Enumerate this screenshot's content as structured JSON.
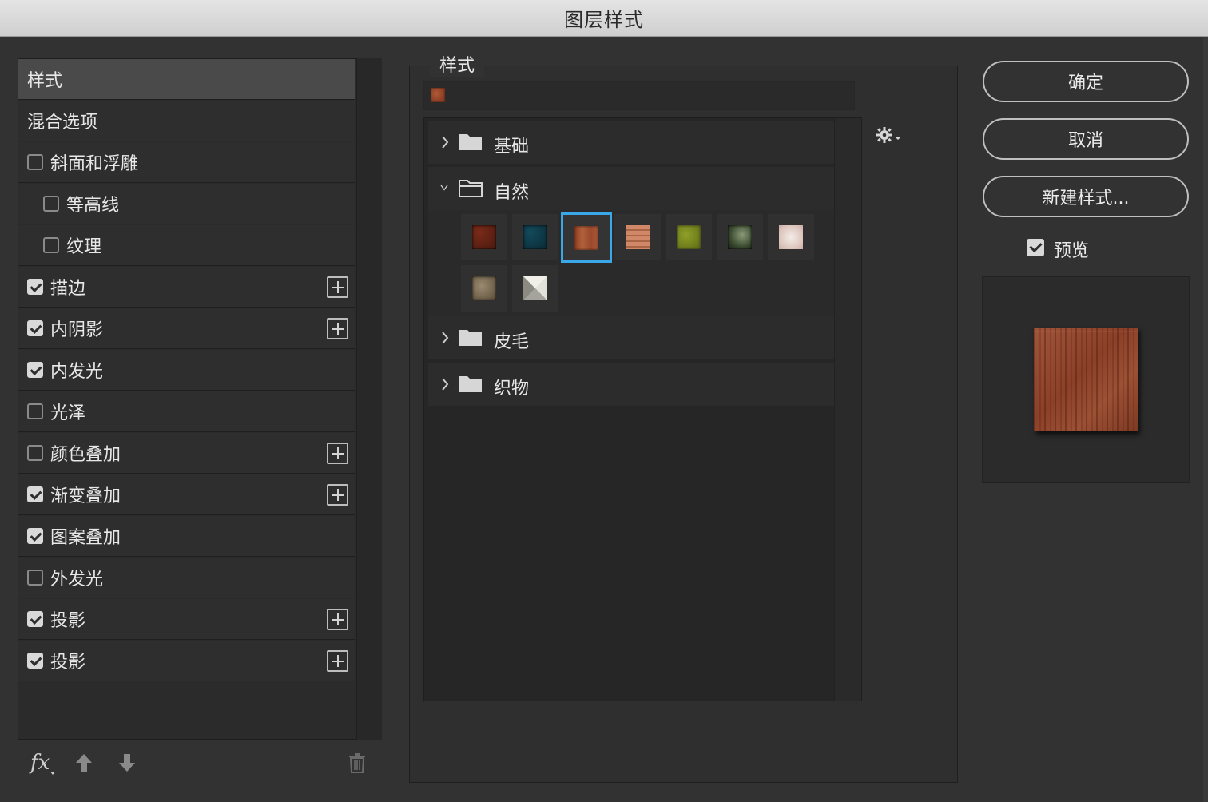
{
  "window": {
    "title": "图层样式"
  },
  "left_panel": {
    "items": [
      {
        "label": "样式",
        "type": "header",
        "checkbox": null,
        "plus": false,
        "indent": false
      },
      {
        "label": "混合选项",
        "type": "plain",
        "checkbox": null,
        "plus": false,
        "indent": false
      },
      {
        "label": "斜面和浮雕",
        "type": "check",
        "checkbox": false,
        "plus": false,
        "indent": false
      },
      {
        "label": "等高线",
        "type": "check",
        "checkbox": false,
        "plus": false,
        "indent": true
      },
      {
        "label": "纹理",
        "type": "check",
        "checkbox": false,
        "plus": false,
        "indent": true
      },
      {
        "label": "描边",
        "type": "check",
        "checkbox": true,
        "plus": true,
        "indent": false
      },
      {
        "label": "内阴影",
        "type": "check",
        "checkbox": true,
        "plus": true,
        "indent": false
      },
      {
        "label": "内发光",
        "type": "check",
        "checkbox": true,
        "plus": false,
        "indent": false
      },
      {
        "label": "光泽",
        "type": "check",
        "checkbox": false,
        "plus": false,
        "indent": false
      },
      {
        "label": "颜色叠加",
        "type": "check",
        "checkbox": false,
        "plus": true,
        "indent": false
      },
      {
        "label": "渐变叠加",
        "type": "check",
        "checkbox": true,
        "plus": true,
        "indent": false
      },
      {
        "label": "图案叠加",
        "type": "check",
        "checkbox": true,
        "plus": false,
        "indent": false
      },
      {
        "label": "外发光",
        "type": "check",
        "checkbox": false,
        "plus": false,
        "indent": false
      },
      {
        "label": "投影",
        "type": "check",
        "checkbox": true,
        "plus": true,
        "indent": false
      },
      {
        "label": "投影",
        "type": "check",
        "checkbox": true,
        "plus": true,
        "indent": false
      }
    ],
    "footer": {
      "fx_label": "fx"
    }
  },
  "styles_panel": {
    "legend": "样式",
    "groups": [
      {
        "name": "基础",
        "expanded": false
      },
      {
        "name": "自然",
        "expanded": true
      },
      {
        "name": "皮毛",
        "expanded": false
      },
      {
        "name": "织物",
        "expanded": false
      }
    ],
    "swatch_colors": [
      "#6b2416",
      "#0d3a4a",
      "#9a4a2c",
      "#c07a5a",
      "#7a8a1e",
      "#4a5a40",
      "#e8d8d4",
      "#6a5a48",
      "#c8c8c0"
    ],
    "selected_swatch": 2
  },
  "buttons": {
    "ok": "确定",
    "cancel": "取消",
    "new_style": "新建样式..."
  },
  "preview": {
    "label": "预览",
    "checked": true
  },
  "colors": {
    "accent": "#3aa8e8",
    "selected_tex": "#9a4a2c"
  }
}
